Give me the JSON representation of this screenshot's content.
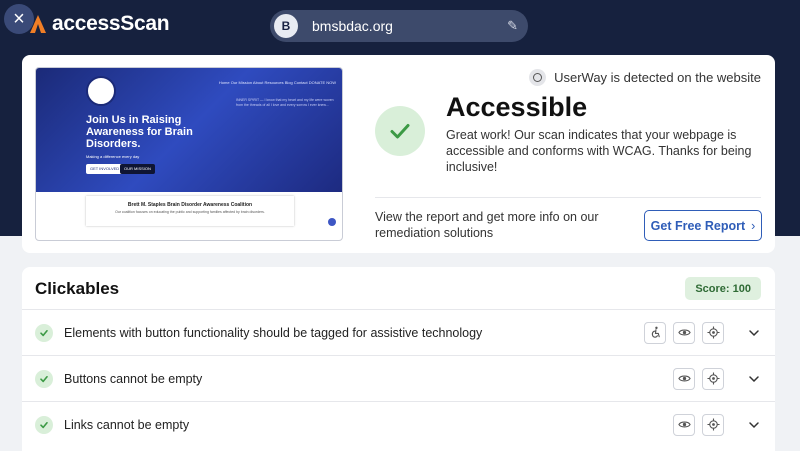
{
  "app": {
    "name": "accessScan"
  },
  "header": {
    "url_initial": "B",
    "url": "bmsbdac.org"
  },
  "preview": {
    "nav_text": "Home  Our Mission  About  Resources  Blog  Contact  DONATE NOW",
    "headline": "Join Us in Raising Awareness for Brain Disorders.",
    "tagline": "Making a difference every day",
    "btn_primary": "GET INVOLVED",
    "btn_secondary": "OUR MISSION",
    "poem": "INNER SPIRIT — I know that my heart and my life were woven from the threads of all I love and every sorrow I ever knew...",
    "box_title": "Brett M. Staples Brain Disorder Awareness Coalition",
    "box_text": "Our coalition focuses on educating the public and supporting families affected by brain disorders."
  },
  "status": {
    "detected": "UserWay is detected on the website",
    "title": "Accessible",
    "message": "Great work! Our scan indicates that your webpage is accessible and conforms with WCAG. Thanks for being inclusive!",
    "report_text": "View the report and get more info on our remediation solutions",
    "report_button": "Get Free Report"
  },
  "clickables": {
    "title": "Clickables",
    "score": "Score: 100",
    "rules": [
      {
        "label": "Elements with button functionality should be tagged for assistive technology",
        "icons": [
          "accessibility-icon",
          "eye-icon",
          "target-icon"
        ]
      },
      {
        "label": "Buttons cannot be empty",
        "icons": [
          "eye-icon",
          "target-icon"
        ]
      },
      {
        "label": "Links cannot be empty",
        "icons": [
          "eye-icon",
          "target-icon"
        ]
      }
    ]
  },
  "colors": {
    "header_bg": "#16213e",
    "accent": "#2f5db8",
    "success": "#3c9a45",
    "logo_orange": "#f07e26"
  }
}
